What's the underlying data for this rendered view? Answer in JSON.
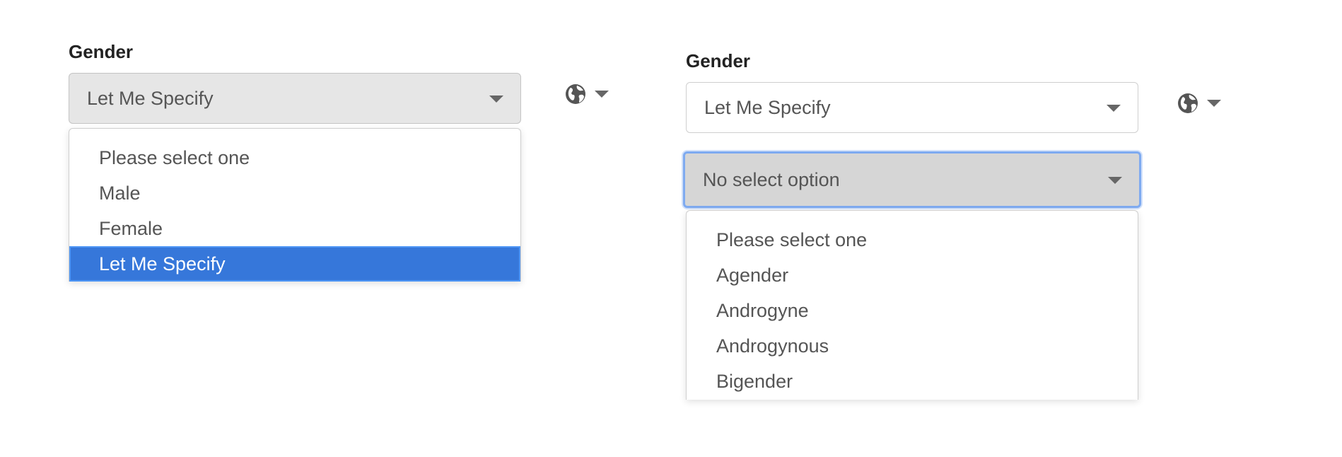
{
  "left": {
    "label": "Gender",
    "select_value": "Let Me Specify",
    "options": [
      {
        "label": "Please select one"
      },
      {
        "label": "Male"
      },
      {
        "label": "Female"
      },
      {
        "label": "Let Me Specify",
        "selected": true
      }
    ],
    "language_icon": "globe-icon"
  },
  "right": {
    "label": "Gender",
    "select_value": "Let Me Specify",
    "secondary_select_value": "No select option",
    "options": [
      {
        "label": "Please select one"
      },
      {
        "label": "Agender"
      },
      {
        "label": "Androgyne"
      },
      {
        "label": "Androgynous"
      },
      {
        "label": "Bigender"
      }
    ],
    "language_icon": "globe-icon"
  },
  "colors": {
    "selected_option": "#3677da",
    "focus_ring": "#7eaaf0"
  }
}
